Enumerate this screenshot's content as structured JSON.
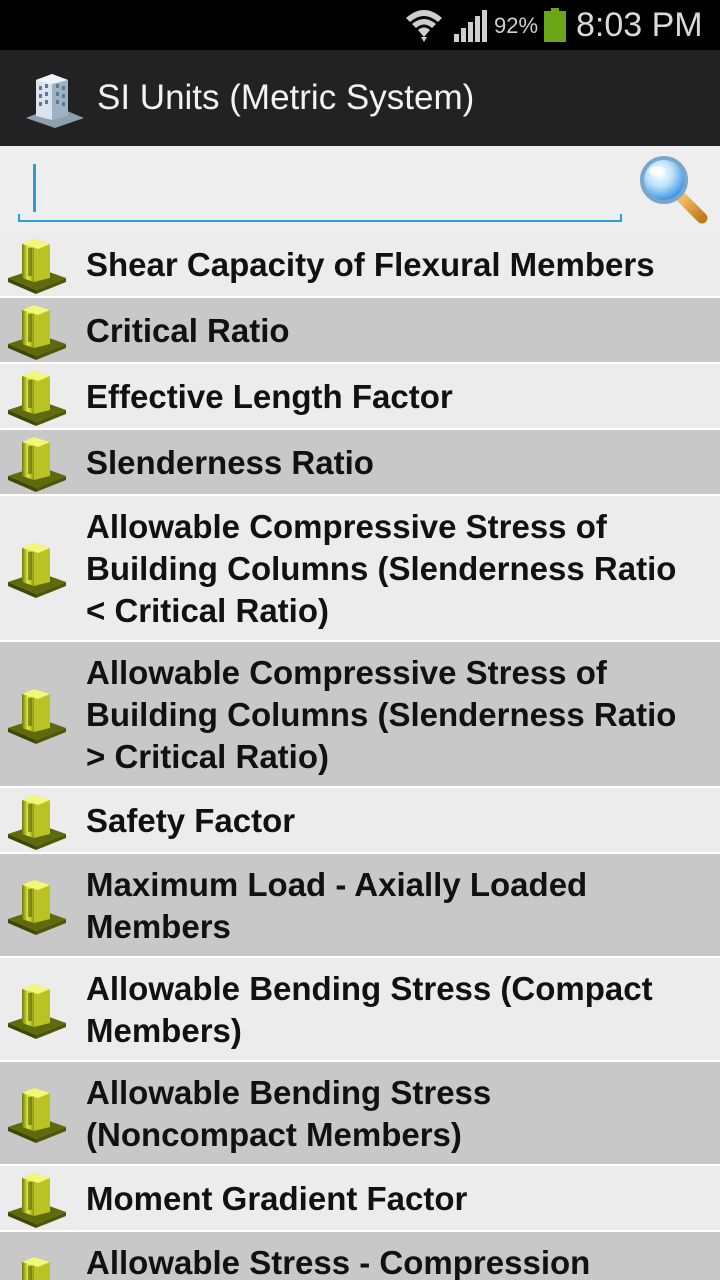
{
  "status_bar": {
    "battery_percent": "92%",
    "time": "8:03 PM",
    "battery_color": "#6aa51a"
  },
  "action_bar": {
    "title": "SI Units (Metric System)"
  },
  "search": {
    "value": "",
    "placeholder": "",
    "accent_color": "#2aa0d8"
  },
  "list": {
    "items": [
      {
        "label": "Shear Capacity of Flexural Members"
      },
      {
        "label": "Critical Ratio"
      },
      {
        "label": "Effective Length Factor"
      },
      {
        "label": "Slenderness Ratio"
      },
      {
        "label": "Allowable Compressive Stress of Building Columns (Slenderness Ratio < Critical Ratio)"
      },
      {
        "label": "Allowable Compressive Stress of Building Columns (Slenderness Ratio > Critical Ratio)"
      },
      {
        "label": "Safety Factor"
      },
      {
        "label": "Maximum Load - Axially Loaded Members"
      },
      {
        "label": "Allowable Bending Stress (Compact Members)"
      },
      {
        "label": "Allowable Bending Stress (Noncompact Members)"
      },
      {
        "label": "Moment Gradient Factor"
      },
      {
        "label": "Allowable Stress - Compression"
      }
    ]
  }
}
